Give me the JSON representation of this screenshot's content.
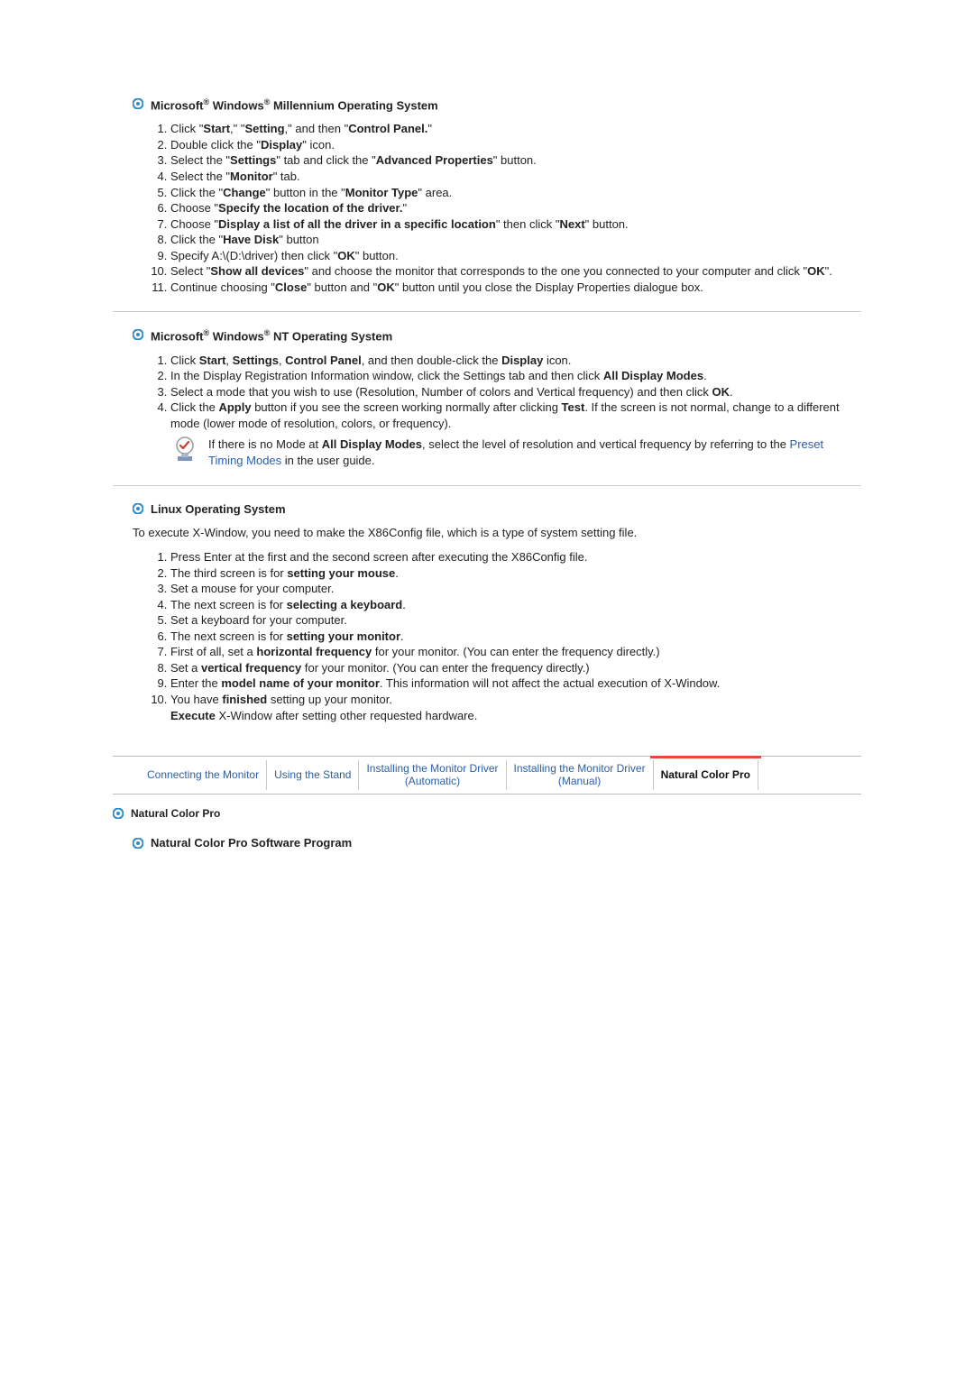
{
  "sections": {
    "me": {
      "title_parts": [
        "Microsoft",
        "Windows",
        "Millennium Operating System"
      ],
      "steps": [
        "Click \"<b>Start</b>,\" \"<b>Setting</b>,\" and then \"<b>Control Panel.</b>\"",
        "Double click the \"<b>Display</b>\" icon.",
        "Select the \"<b>Settings</b>\" tab and click the \"<b>Advanced Properties</b>\" button.",
        "Select the \"<b>Monitor</b>\" tab.",
        "Click the \"<b>Change</b>\" button in the \"<b>Monitor Type</b>\" area.",
        "Choose \"<b>Specify the location of the driver.</b>\"",
        "Choose \"<b>Display a list of all the driver in a specific location</b>\" then click \"<b>Next</b>\" button.",
        "Click the \"<b>Have Disk</b>\" button",
        "Specify A:\\(D:\\driver) then click \"<b>OK</b>\" button.",
        "Select \"<b>Show all devices</b>\" and choose the monitor that corresponds to the one you connected to your computer and click \"<b>OK</b>\".",
        "Continue choosing \"<b>Close</b>\" button and \"<b>OK</b>\" button until you close the Display Properties dialogue box."
      ]
    },
    "nt": {
      "title_parts": [
        "Microsoft",
        "Windows",
        "NT Operating System"
      ],
      "steps": [
        "Click <b>Start</b>, <b>Settings</b>, <b>Control Panel</b>, and then double-click the <b>Display</b> icon.",
        "In the Display Registration Information window, click the Settings tab and then click <b>All Display Modes</b>.",
        "Select a mode that you wish to use (Resolution, Number of colors and Vertical frequency) and then click <b>OK</b>.",
        "Click the <b>Apply</b> button if you see the screen working normally after clicking <b>Test</b>. If the screen is not normal, change to a different mode (lower mode of resolution, colors, or frequency)."
      ],
      "note_prefix": "If there is no Mode at ",
      "note_bold": "All Display Modes",
      "note_mid": ", select the level of resolution and vertical frequency by referring to the ",
      "note_link": "Preset Timing Modes",
      "note_suffix": " in the user guide."
    },
    "linux": {
      "title": "Linux Operating System",
      "intro": "To execute X-Window, you need to make the X86Config file, which is a type of system setting file.",
      "steps": [
        "Press Enter at the first and the second screen after executing the X86Config file.",
        "The third screen is for <b>setting your mouse</b>.",
        "Set a mouse for your computer.",
        "The next screen is for <b>selecting a keyboard</b>.",
        "Set a keyboard for your computer.",
        "The next screen is for <b>setting your monitor</b>.",
        "First of all, set a <b>horizontal frequency</b> for your monitor. (You can enter the frequency directly.)",
        "Set a <b>vertical frequency</b> for your monitor. (You can enter the frequency directly.)",
        "Enter the <b>model name of your monitor</b>. This information will not affect the actual execution of X-Window.",
        "You have <b>finished</b> setting up your monitor.<br><b>Execute</b> X-Window after setting other requested hardware."
      ]
    }
  },
  "tabs": {
    "t1": "Connecting the Monitor",
    "t2": "Using the Stand",
    "t3_line1": "Installing the Monitor Driver",
    "t3_line2": "(Automatic)",
    "t4_line1": "Installing the Monitor Driver",
    "t4_line2": "(Manual)",
    "t5": "Natural Color Pro"
  },
  "footer": {
    "head1": "Natural Color Pro",
    "head2": "Natural Color Pro Software Program"
  }
}
